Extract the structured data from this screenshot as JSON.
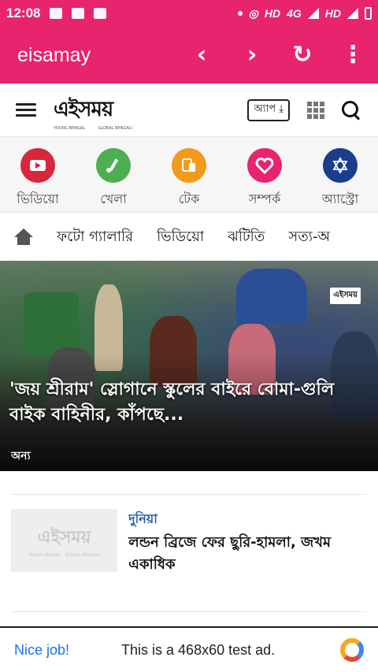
{
  "status_bar": {
    "time": "12:08",
    "network1": "HD",
    "network2": "4G",
    "network3": "HD"
  },
  "toolbar": {
    "title": "eisamay",
    "back_icon": "chevron-left-icon",
    "forward_icon": "chevron-right-icon",
    "reload_icon": "reload-icon",
    "menu_icon": "more-vert-icon"
  },
  "header": {
    "logo_text": "এইসময়",
    "logo_sub_left": "YOUNG BENGAL",
    "logo_sub_right": "GLOBAL BENGALI",
    "app_button": "অ্যাপ ⤓"
  },
  "categories": [
    {
      "label": "ভিডিয়ো",
      "color": "#d7263d",
      "icon": "play-icon"
    },
    {
      "label": "খেলা",
      "color": "#4caf50",
      "icon": "cricket-icon"
    },
    {
      "label": "টেক",
      "color": "#f29a1a",
      "icon": "devices-icon"
    },
    {
      "label": "সম্পর্ক",
      "color": "#e8246f",
      "icon": "heart-icon"
    },
    {
      "label": "অ্যাস্ট্রো",
      "color": "#1a3e8c",
      "icon": "star-icon"
    }
  ],
  "nav": {
    "items": [
      "ফটো গ্যালারি",
      "ভিডিয়ো",
      "ঝটিতি",
      "সত্য-অ"
    ]
  },
  "hero": {
    "caption": "'জয় শ্রীরাম' স্লোগানে স্কুলের বাইরে বোমা-গুলি বাইক বাহিনীর, কাঁপছে...",
    "tag": "অন্য",
    "watermark": "এইসময়"
  },
  "article": {
    "category": "দুনিয়া",
    "title": "লন্ডন ব্রিজে ফের ছুরি-হামলা, জখম একাধিক",
    "thumb_text": "এইসময়",
    "thumb_sub_left": "YOUNG BENGAL",
    "thumb_sub_right": "GLOBAL BENGALI"
  },
  "ad": {
    "nice": "Nice job!",
    "message": "This is a 468x60 test ad."
  }
}
